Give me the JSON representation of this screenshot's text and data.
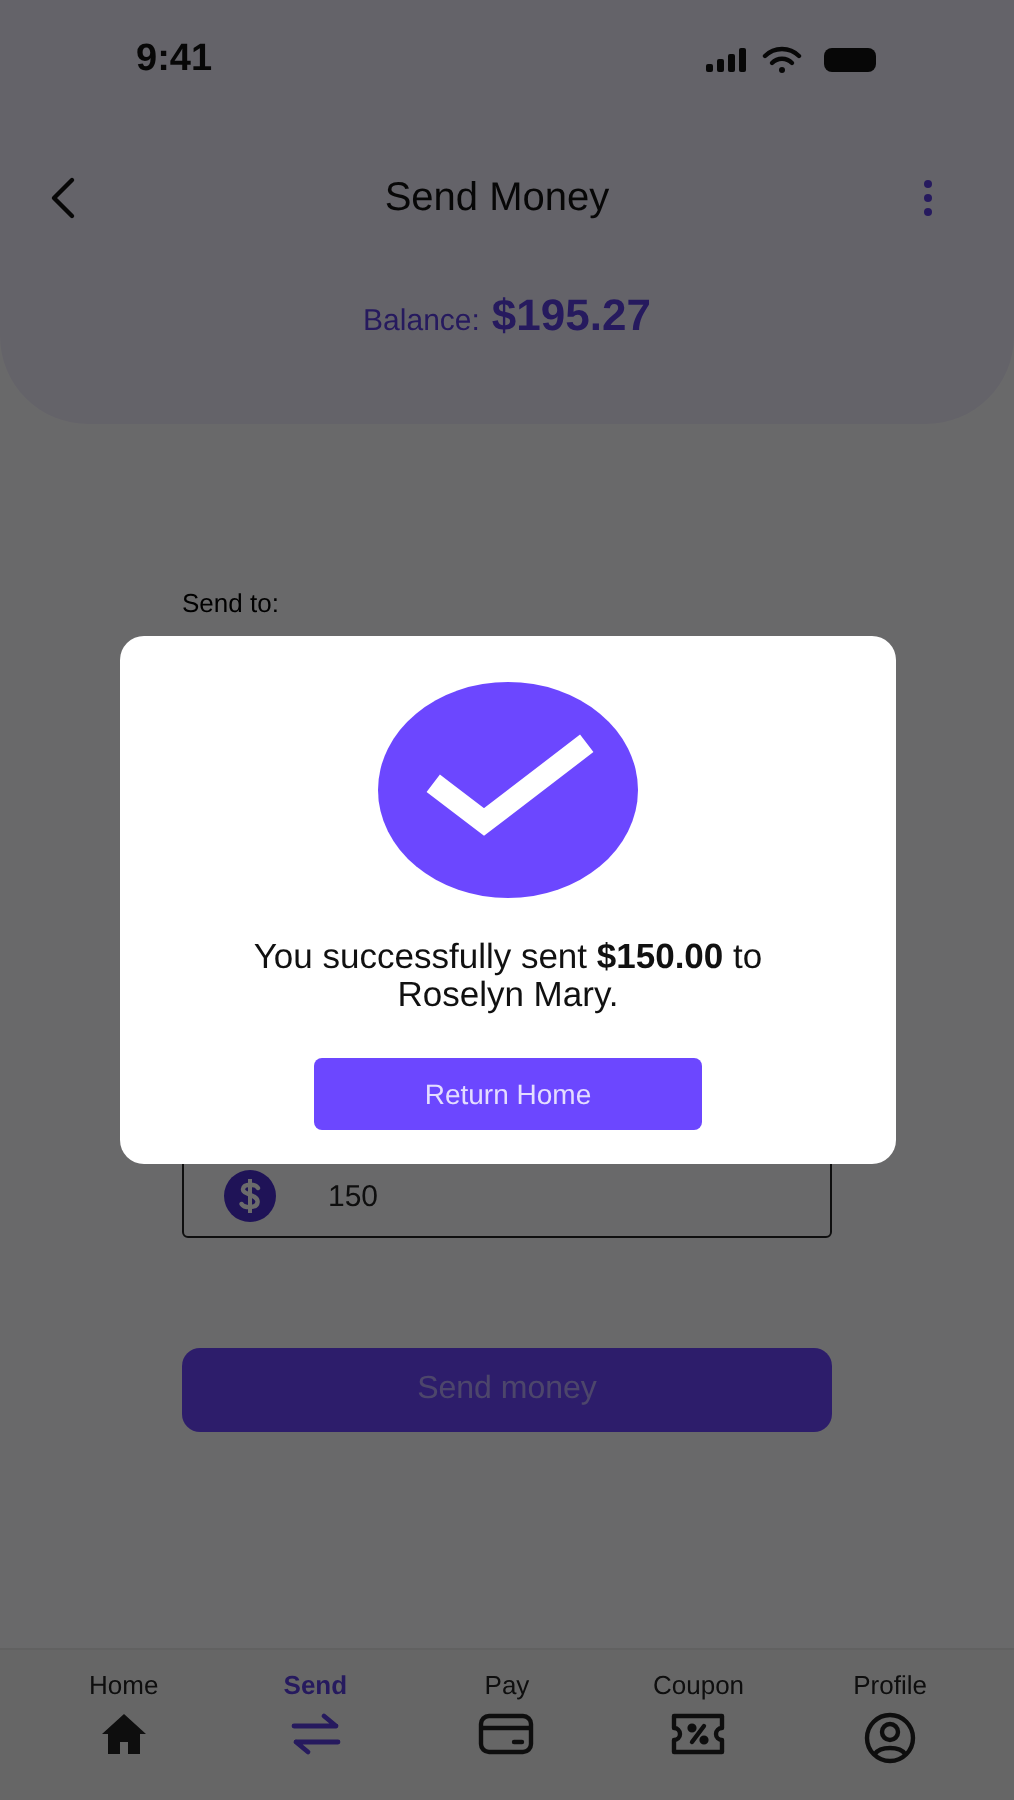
{
  "status_bar": {
    "time": "9:41"
  },
  "header": {
    "title": "Send Money",
    "balance_label": "Balance:",
    "balance_amount": "$195.27"
  },
  "form": {
    "send_to_label": "Send to:",
    "amount_value": "150",
    "send_button": "Send money"
  },
  "dialog": {
    "message": "You successfully sent **$150.00** to Roselyn Mary.",
    "button": "Return Home"
  },
  "nav": [
    {
      "label": "Home",
      "kind": "home",
      "selected": false
    },
    {
      "label": "Send",
      "kind": "send",
      "selected": true
    },
    {
      "label": "Pay",
      "kind": "pay",
      "selected": false
    },
    {
      "label": "Coupon",
      "kind": "coupon",
      "selected": false
    },
    {
      "label": "Profile",
      "kind": "profile",
      "selected": false
    }
  ]
}
